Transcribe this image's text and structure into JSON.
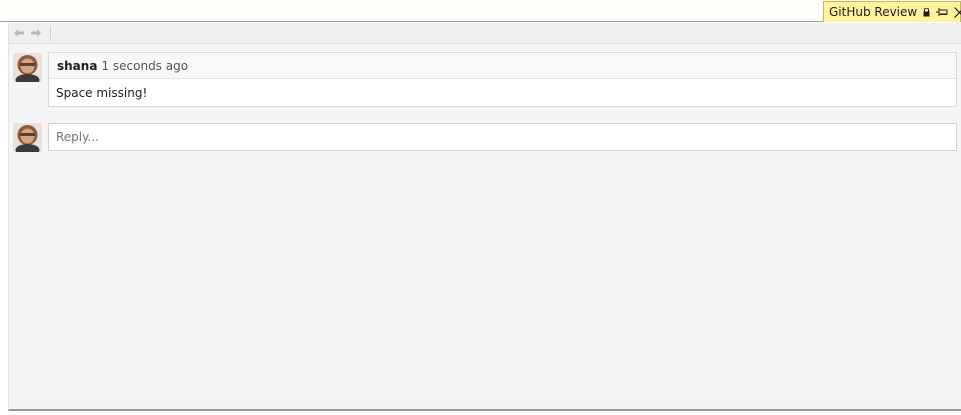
{
  "tab": {
    "title": "GitHub Review",
    "icons": [
      "lock-icon",
      "pin-icon",
      "close-icon"
    ]
  },
  "toolbar": {
    "back_icon": "back-arrow-icon",
    "forward_icon": "forward-arrow-icon"
  },
  "comment": {
    "author": "shana",
    "timestamp": "1 seconds ago",
    "body": "Space missing!"
  },
  "reply": {
    "placeholder": "Reply..."
  },
  "colors": {
    "tab_background": "#fff29d",
    "panel_background": "#f5f5f5"
  }
}
